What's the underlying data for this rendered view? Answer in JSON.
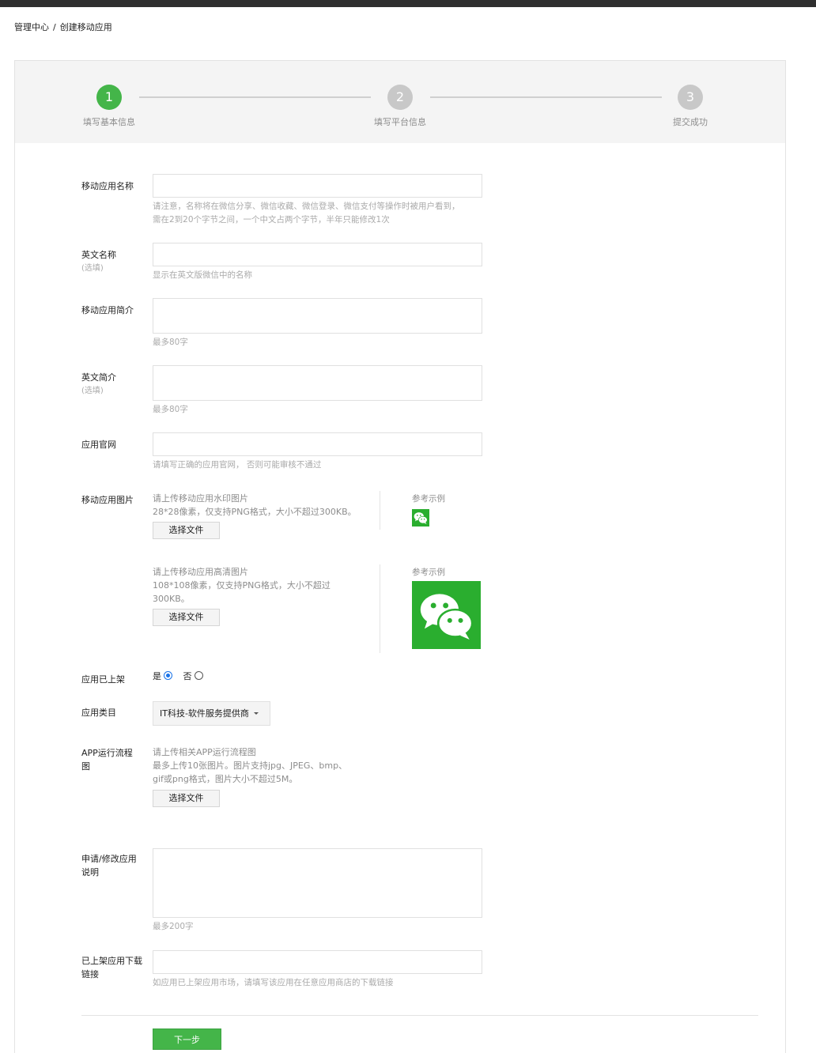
{
  "breadcrumb": {
    "home": "管理中心",
    "separator": "/",
    "current": "创建移动应用"
  },
  "steps": [
    {
      "number": "1",
      "label": "填写基本信息",
      "state": "active"
    },
    {
      "number": "2",
      "label": "填写平台信息",
      "state": "inactive"
    },
    {
      "number": "3",
      "label": "提交成功",
      "state": "inactive"
    }
  ],
  "form": {
    "app_name": {
      "label": "移动应用名称",
      "value": "",
      "hint_line1": "请注意，名称将在微信分享、微信收藏、微信登录、微信支付等操作时被用户看到，",
      "hint_line2": "需在2到20个字节之间，一个中文占两个字节，半年只能修改1次"
    },
    "english_name": {
      "label": "英文名称",
      "optional": "(选填)",
      "value": "",
      "hint": "显示在英文版微信中的名称"
    },
    "app_intro": {
      "label": "移动应用简介",
      "value": "",
      "hint": "最多80字"
    },
    "english_intro": {
      "label": "英文简介",
      "optional": "(选填)",
      "value": "",
      "hint": "最多80字"
    },
    "website": {
      "label": "应用官网",
      "value": "",
      "hint": "请填写正确的应用官网， 否则可能审核不通过"
    },
    "app_images": {
      "label": "移动应用图片",
      "watermark": {
        "line1": "请上传移动应用水印图片",
        "line2": "28*28像素，仅支持PNG格式，大小不超过300KB。",
        "button": "选择文件",
        "ref_label": "参考示例"
      },
      "hd": {
        "line1": "请上传移动应用高清图片",
        "line2": "108*108像素，仅支持PNG格式，大小不超过",
        "line3": "300KB。",
        "button": "选择文件",
        "ref_label": "参考示例"
      }
    },
    "listed": {
      "label": "应用已上架",
      "yes": "是",
      "no": "否",
      "selected": "是"
    },
    "category": {
      "label": "应用类目",
      "value": "IT科技-软件服务提供商"
    },
    "flow": {
      "label_line1": "APP运行流程",
      "label_line2": "图",
      "line1": "请上传相关APP运行流程图",
      "line2": "最多上传10张图片。图片支持jpg、JPEG、bmp、",
      "line3": "gif或png格式，图片大小不超过5M。",
      "button": "选择文件"
    },
    "reason": {
      "label_line1": "申请/修改应用",
      "label_line2": "说明",
      "value": "",
      "hint": "最多200字"
    },
    "download_link": {
      "label_line1": "已上架应用下载",
      "label_line2": "链接",
      "value": "",
      "hint": "如应用已上架应用市场，请填写该应用在任意应用商店的下载链接"
    }
  },
  "next_button": "下一步",
  "colors": {
    "accent": "#44b549",
    "wechat_green": "#2aae2f",
    "radio_blue": "#1a73e8",
    "topbar": "#2f2f2f"
  },
  "icons": {
    "wechat_small": "wechat-logo-icon",
    "wechat_large": "wechat-logo-icon"
  }
}
